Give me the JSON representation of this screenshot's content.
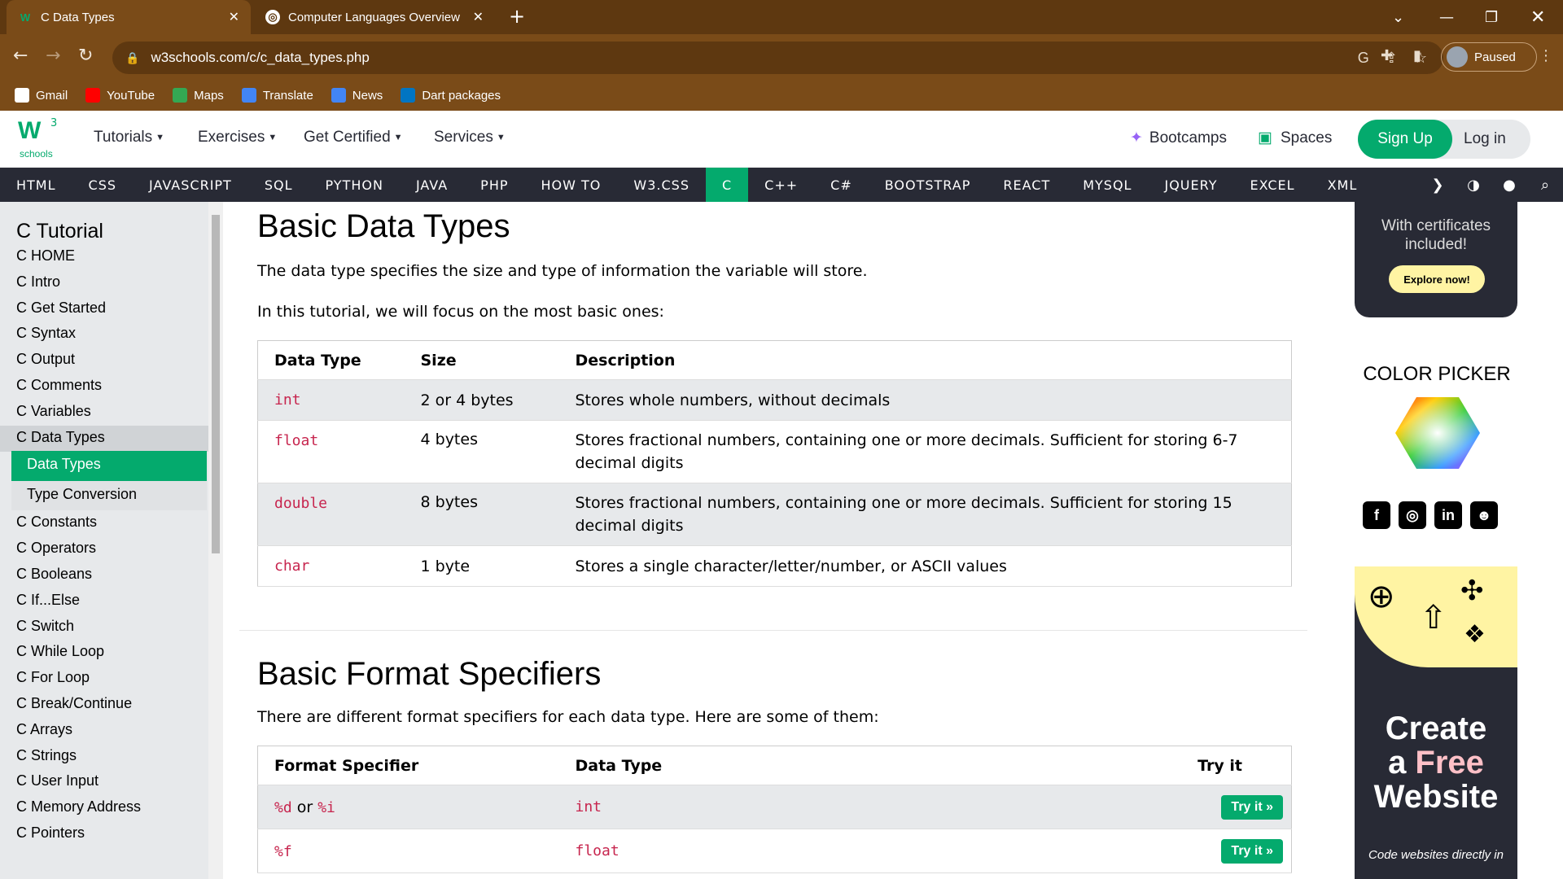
{
  "browser": {
    "tabs": [
      {
        "title": "C Data Types",
        "active": true
      },
      {
        "title": "Computer Languages Overview",
        "active": false
      }
    ],
    "url": "w3schools.com/c/c_data_types.php",
    "profile_status": "Paused",
    "bookmarks": [
      {
        "label": "Gmail",
        "icon": "google-icon",
        "color": "#ffffff"
      },
      {
        "label": "YouTube",
        "icon": "youtube-icon",
        "color": "#ff0000"
      },
      {
        "label": "Maps",
        "icon": "maps-icon",
        "color": "#34a853"
      },
      {
        "label": "Translate",
        "icon": "translate-icon",
        "color": "#4285f4"
      },
      {
        "label": "News",
        "icon": "news-icon",
        "color": "#4285f4"
      },
      {
        "label": "Dart packages",
        "icon": "dart-icon",
        "color": "#0175c2"
      }
    ],
    "colors": {
      "frame": "#5e3810",
      "toolbar": "#7a4b18"
    }
  },
  "site": {
    "logo_text": "W",
    "logo_sup": "3",
    "logo_sub": "schools",
    "menu": [
      {
        "label": "Tutorials"
      },
      {
        "label": "Exercises"
      },
      {
        "label": "Get Certified"
      },
      {
        "label": "Services"
      }
    ],
    "bootcamps": "Bootcamps",
    "spaces": "Spaces",
    "signup": "Sign Up",
    "login": "Log in",
    "accent": "#04aa6d",
    "langbar": [
      "HTML",
      "CSS",
      "JAVASCRIPT",
      "SQL",
      "PYTHON",
      "JAVA",
      "PHP",
      "HOW TO",
      "W3.CSS",
      "C",
      "C++",
      "C#",
      "BOOTSTRAP",
      "REACT",
      "MYSQL",
      "JQUERY",
      "EXCEL",
      "XML"
    ],
    "langbar_active": "C"
  },
  "sidebar": {
    "title": "C Tutorial",
    "items": [
      "C HOME",
      "C Intro",
      "C Get Started",
      "C Syntax",
      "C Output",
      "C Comments",
      "C Variables",
      "C Data Types"
    ],
    "sub_items": [
      "Data Types",
      "Type Conversion"
    ],
    "items_after": [
      "C Constants",
      "C Operators",
      "C Booleans",
      "C If...Else",
      "C Switch",
      "C While Loop",
      "C For Loop",
      "C Break/Continue",
      "C Arrays",
      "C Strings",
      "C User Input",
      "C Memory Address",
      "C Pointers"
    ]
  },
  "main": {
    "heading1": "Basic Data Types",
    "p1": "The data type specifies the size and type of information the variable will store.",
    "p2": "In this tutorial, we will focus on the most basic ones:",
    "table1": {
      "headers": [
        "Data Type",
        "Size",
        "Description"
      ],
      "rows": [
        {
          "type": "int",
          "size": "2 or 4 bytes",
          "desc": "Stores whole numbers, without decimals"
        },
        {
          "type": "float",
          "size": "4 bytes",
          "desc": "Stores fractional numbers, containing one or more decimals. Sufficient for storing 6-7 decimal digits"
        },
        {
          "type": "double",
          "size": "8 bytes",
          "desc": "Stores fractional numbers, containing one or more decimals. Sufficient for storing 15 decimal digits"
        },
        {
          "type": "char",
          "size": "1 byte",
          "desc": "Stores a single character/letter/number, or ASCII values"
        }
      ]
    },
    "heading2": "Basic Format Specifiers",
    "p3": "There are different format specifiers for each data type. Here are some of them:",
    "table2": {
      "headers": [
        "Format Specifier",
        "Data Type",
        "Try it"
      ],
      "rows": [
        {
          "spec1": "%d",
          "or": "or",
          "spec2": "%i",
          "type": "int",
          "btn": "Try it »"
        },
        {
          "spec1": "%f",
          "or": "",
          "spec2": "",
          "type": "float",
          "btn": "Try it »"
        }
      ]
    }
  },
  "right": {
    "ad1_text": "With certificates included!",
    "ad1_button": "Explore now!",
    "color_picker": "COLOR PICKER",
    "social": [
      "facebook-icon",
      "instagram-icon",
      "linkedin-icon",
      "discord-icon"
    ],
    "ad2_line1": "Create",
    "ad2_line2a": "a ",
    "ad2_line2b": "Free",
    "ad2_line3": "Website",
    "ad2_small": "Code websites directly in"
  }
}
